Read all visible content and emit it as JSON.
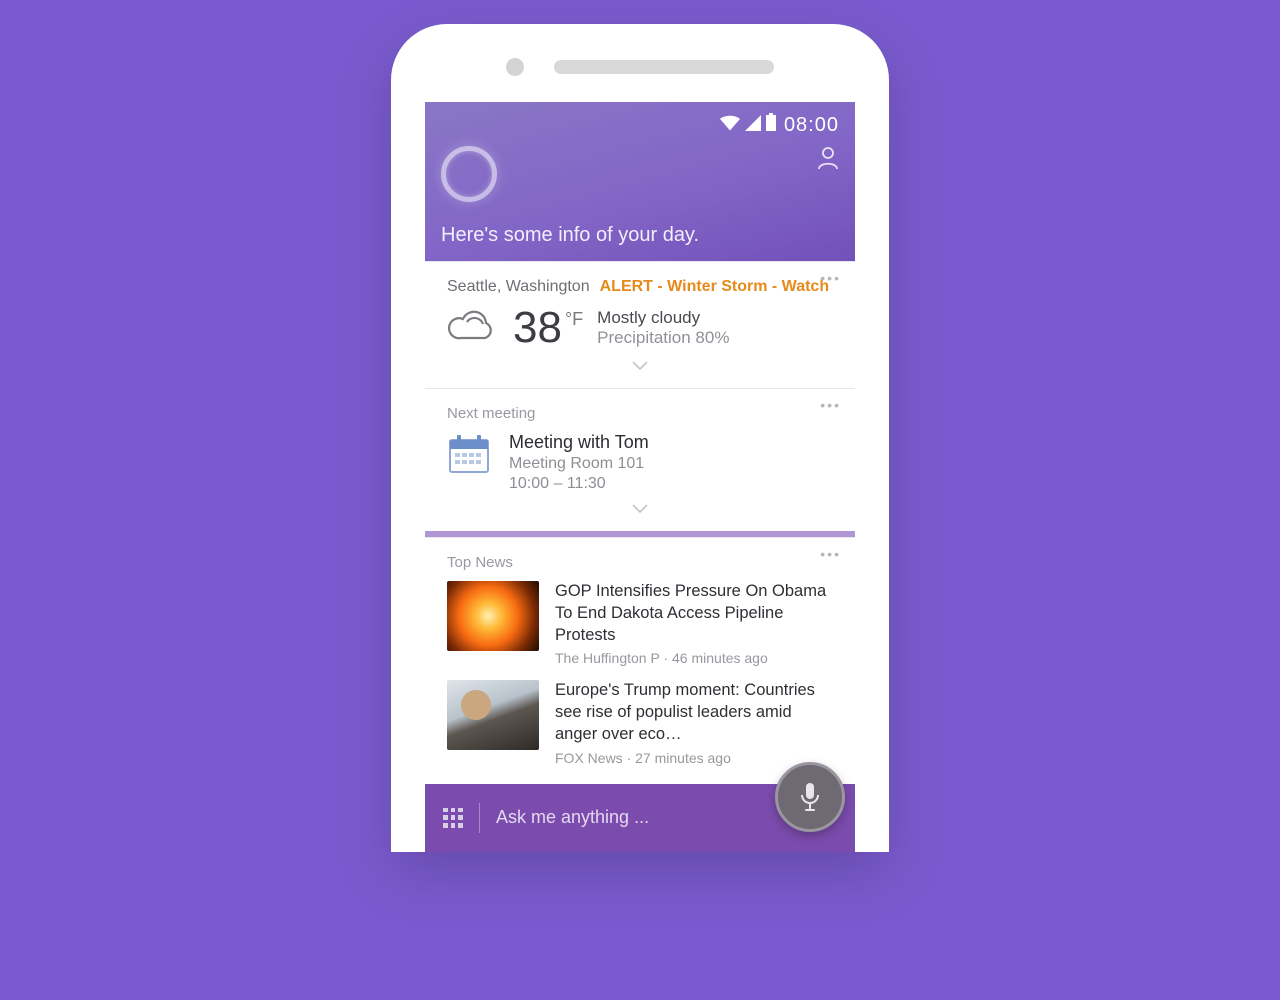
{
  "status": {
    "time": "08:00"
  },
  "header": {
    "greeting": "Here's some info of your day."
  },
  "weather": {
    "location": "Seattle, Washington",
    "alert": "ALERT - Winter Storm - Watch",
    "temp": "38",
    "unit": "°F",
    "condition": "Mostly cloudy",
    "precip": "Precipitation 80%"
  },
  "meeting": {
    "section_label": "Next meeting",
    "title": "Meeting with Tom",
    "room": "Meeting Room 101",
    "time": "10:00 – 11:30"
  },
  "news": {
    "section_label": "Top News",
    "items": [
      {
        "headline": "GOP Intensifies Pressure On Obama To End Dakota Access Pipeline Protests",
        "source": "The Huffington P",
        "age": "46 minutes ago"
      },
      {
        "headline": "Europe's Trump moment: Countries see rise of populist leaders amid anger over eco…",
        "source": "FOX News",
        "age": "27 minutes ago"
      }
    ]
  },
  "ask": {
    "placeholder": "Ask me anything ..."
  }
}
